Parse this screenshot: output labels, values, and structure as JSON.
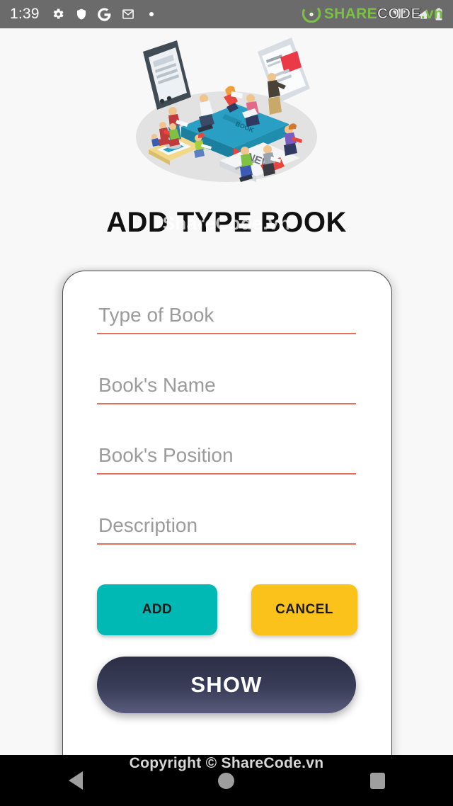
{
  "status_bar": {
    "time": "1:39",
    "icons": [
      "gear-icon",
      "shield-icon",
      "google-g-icon",
      "gmail-icon",
      "dot-indicator"
    ],
    "right_icons": [
      "wifi-icon",
      "signal-icon",
      "battery-icon"
    ],
    "background_color": "#6b6b6b"
  },
  "watermark": {
    "logo_share": "SHARE",
    "logo_code": "CODE",
    "logo_vn": ".vn",
    "brand_green": "#7ac143",
    "title_overlay": "ShareCode.vn",
    "copyright": "Copyright © ShareCode.vn"
  },
  "hero": {
    "illustration_name": "people-reading-books-isometric-illustration",
    "book_label": "BOOK",
    "news_label": "NEWS",
    "base_color": "#e0e0e0",
    "book_color": "#2a9fc4"
  },
  "header": {
    "title": "ADD TYPE BOOK"
  },
  "form": {
    "fields": [
      {
        "name": "type-of-book",
        "placeholder": "Type of Book",
        "value": ""
      },
      {
        "name": "books-name",
        "placeholder": "Book's Name",
        "value": ""
      },
      {
        "name": "books-position",
        "placeholder": "Book's Position",
        "value": ""
      },
      {
        "name": "description",
        "placeholder": "Description",
        "value": ""
      }
    ],
    "underline_color": "#e8705a",
    "placeholder_color": "#9b9b9b"
  },
  "buttons": {
    "add": {
      "label": "ADD",
      "color": "#00b8b4"
    },
    "cancel": {
      "label": "CANCEL",
      "color": "#fbc21c"
    },
    "show": {
      "label": "SHOW",
      "color": "#2b2e45"
    }
  },
  "nav_bar": {
    "back": "back-triangle-icon",
    "home": "home-circle-icon",
    "recents": "recents-square-icon",
    "background_color": "#000000"
  }
}
